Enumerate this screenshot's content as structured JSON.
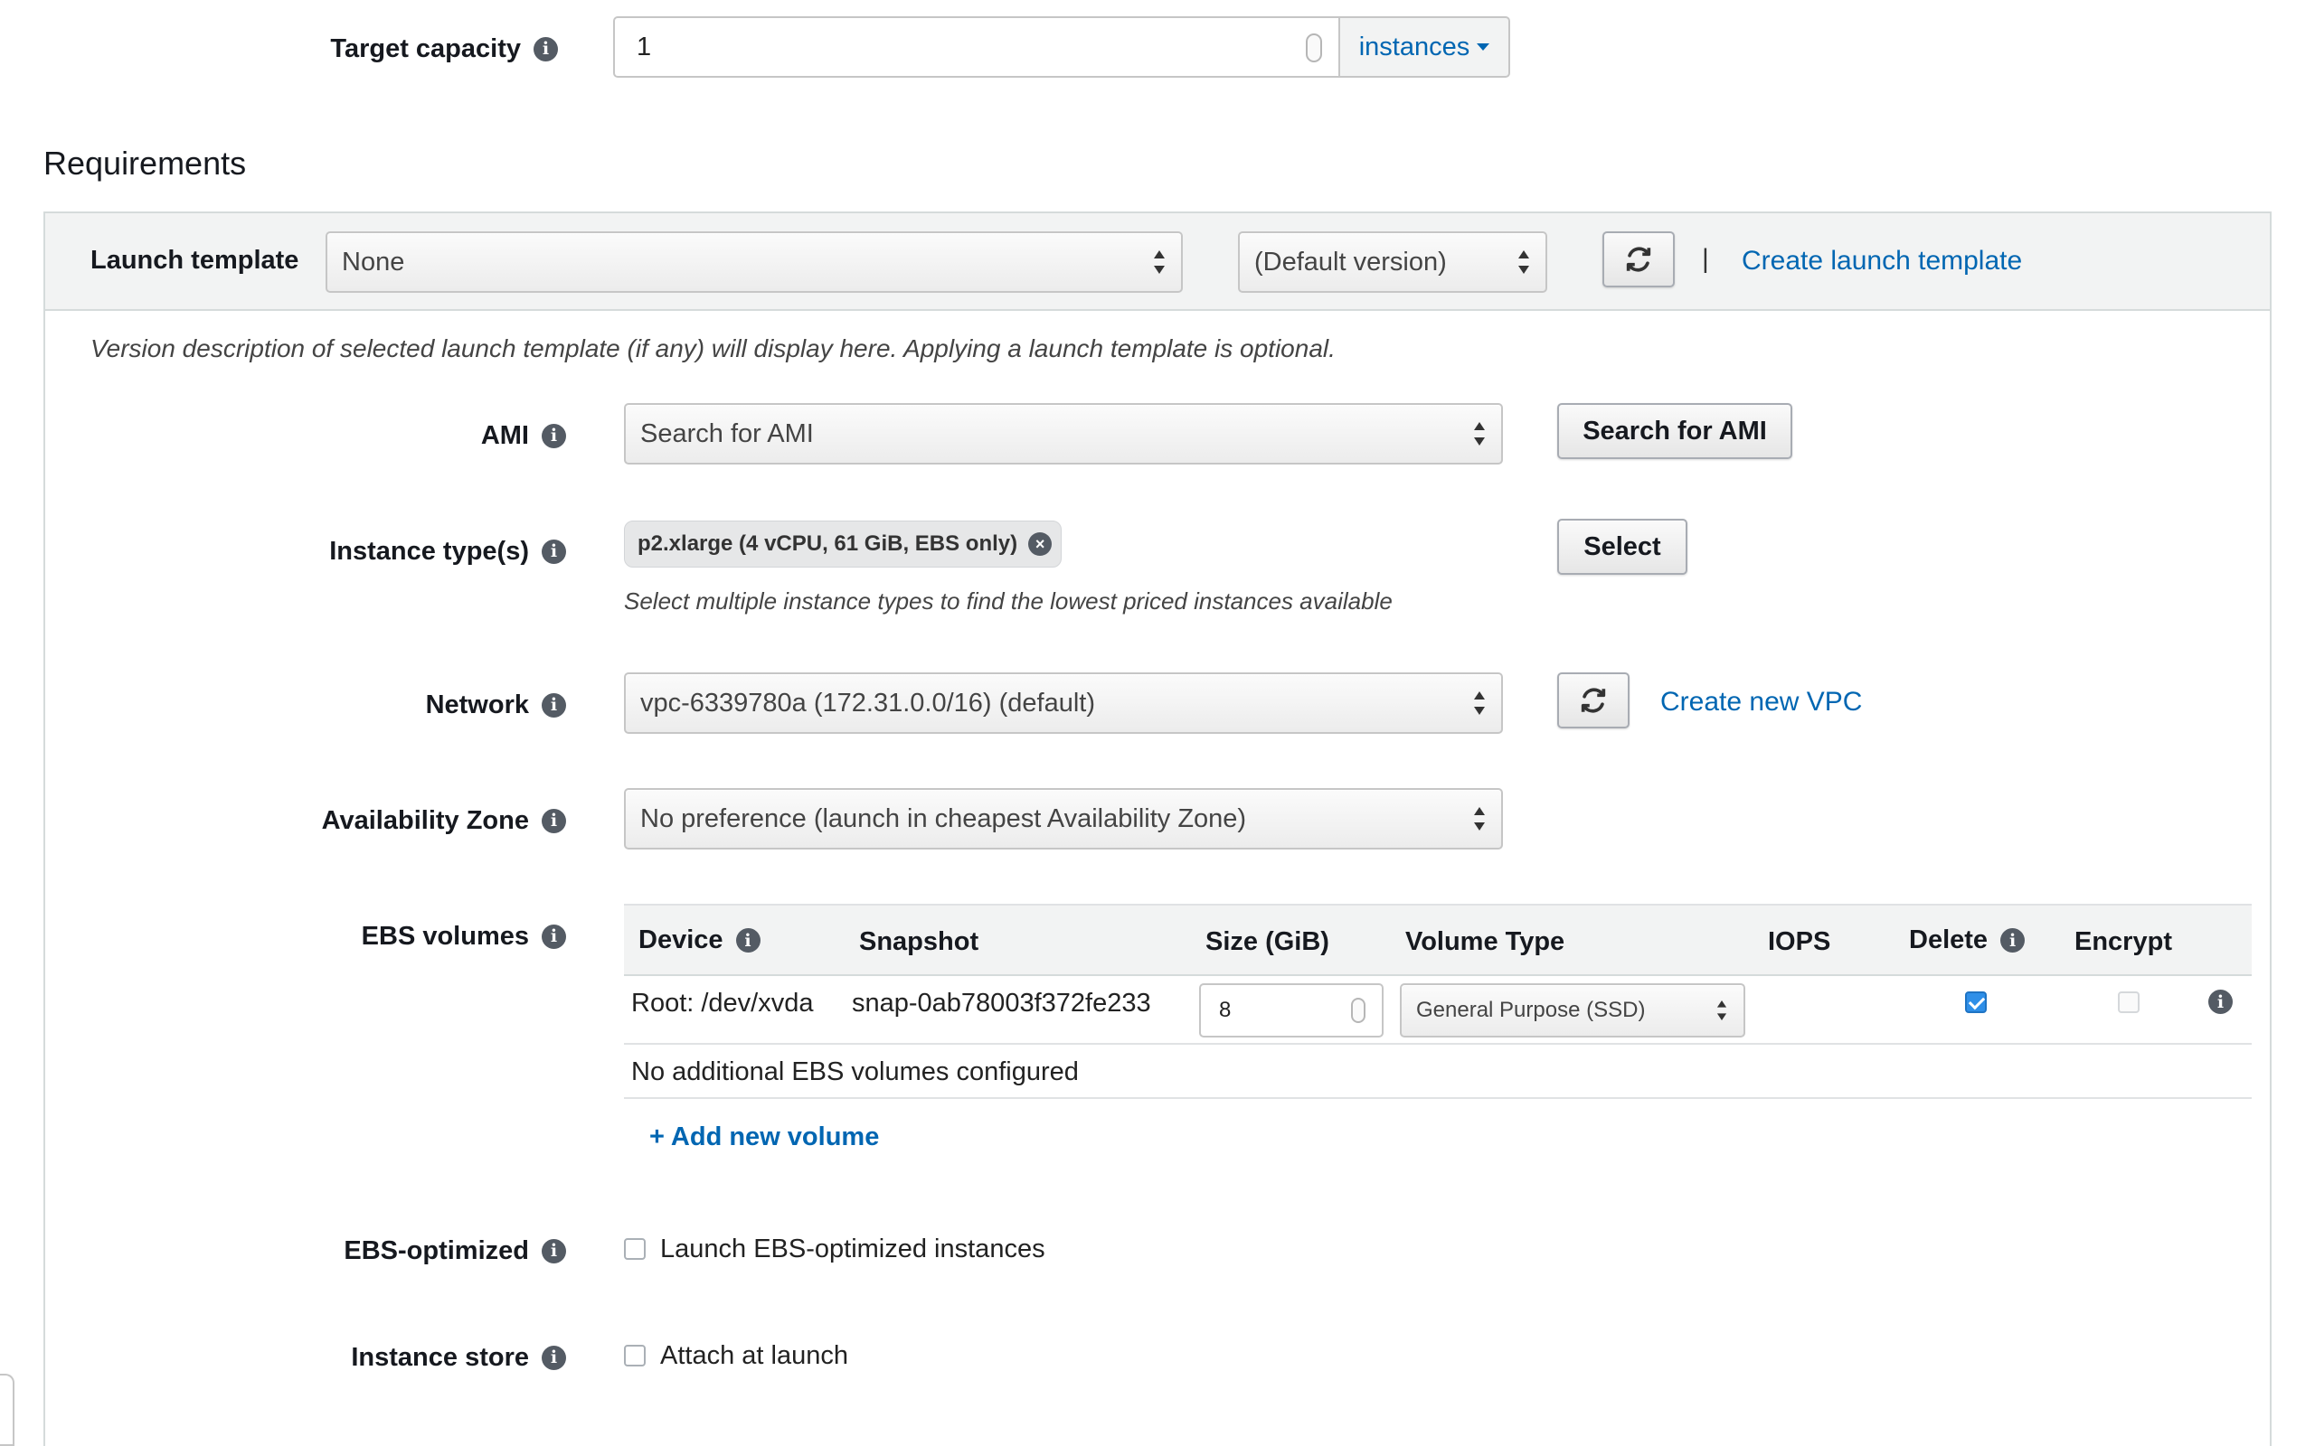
{
  "target_capacity": {
    "label": "Target capacity",
    "value": "1",
    "unit": "instances"
  },
  "requirements": {
    "heading": "Requirements",
    "launch_template": {
      "label": "Launch template",
      "value": "None",
      "version": "(Default version)",
      "separator": "|",
      "create_link": "Create launch template",
      "description": "Version description of selected launch template (if any) will display here. Applying a launch template is optional."
    },
    "ami": {
      "label": "AMI",
      "value": "Search for AMI",
      "button": "Search for AMI"
    },
    "instance_types": {
      "label": "Instance type(s)",
      "token": "p2.xlarge (4 vCPU, 61 GiB, EBS only)",
      "button": "Select",
      "hint": "Select multiple instance types to find the lowest priced instances available"
    },
    "network": {
      "label": "Network",
      "value": "vpc-6339780a (172.31.0.0/16) (default)",
      "create_link": "Create new VPC"
    },
    "availability_zone": {
      "label": "Availability Zone",
      "value": "No preference (launch in cheapest Availability Zone)"
    },
    "ebs_volumes": {
      "label": "EBS volumes",
      "columns": {
        "device": "Device",
        "snapshot": "Snapshot",
        "size": "Size (GiB)",
        "volume_type": "Volume Type",
        "iops": "IOPS",
        "delete": "Delete",
        "encrypt": "Encrypt"
      },
      "rows": [
        {
          "device": "Root: /dev/xvda",
          "snapshot": "snap-0ab78003f372fe233",
          "size": "8",
          "volume_type": "General Purpose (SSD)",
          "iops": "",
          "delete": true,
          "encrypt": false
        }
      ],
      "empty_note": "No additional EBS volumes configured",
      "add_link": "+ Add new volume"
    },
    "ebs_optimized": {
      "label": "EBS-optimized",
      "checkbox_label": "Launch EBS-optimized instances",
      "checked": false
    },
    "instance_store": {
      "label": "Instance store",
      "checkbox_label": "Attach at launch",
      "checked": false
    }
  }
}
